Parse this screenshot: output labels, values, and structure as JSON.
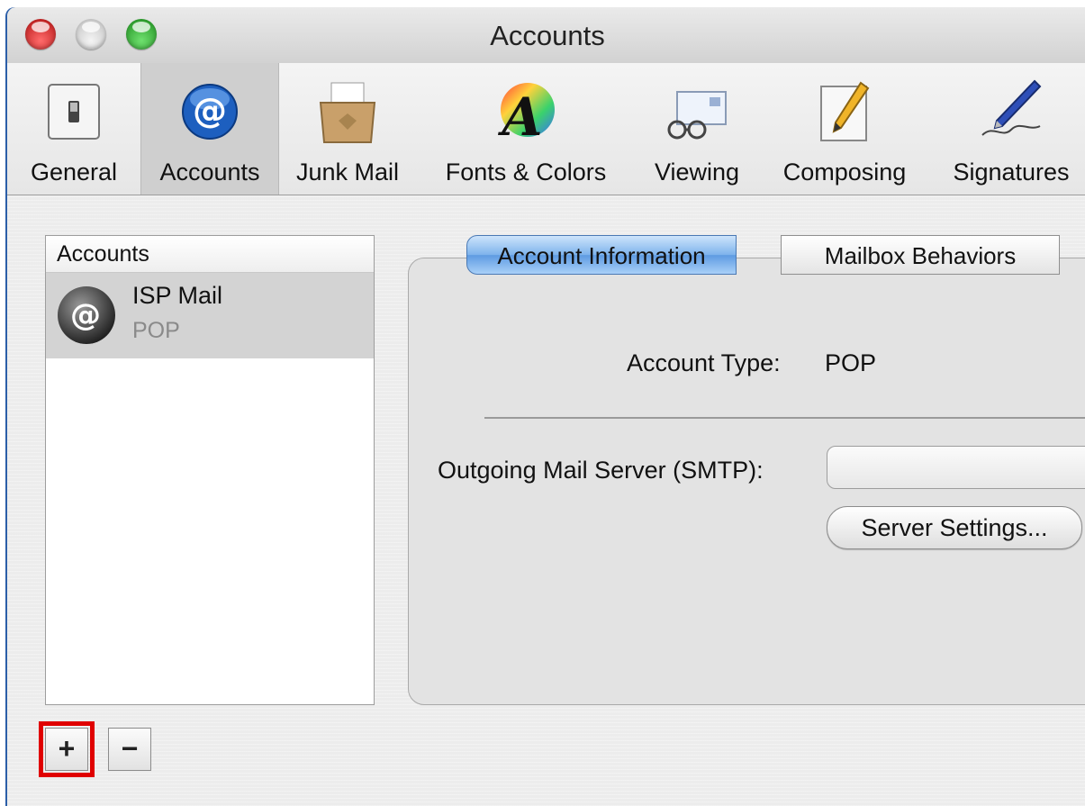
{
  "window": {
    "title": "Accounts"
  },
  "toolbar": {
    "items": [
      {
        "label": "General",
        "icon": "switch-icon"
      },
      {
        "label": "Accounts",
        "icon": "at-sign-icon"
      },
      {
        "label": "Junk Mail",
        "icon": "junk-mail-icon"
      },
      {
        "label": "Fonts & Colors",
        "icon": "color-font-icon"
      },
      {
        "label": "Viewing",
        "icon": "glasses-letter-icon"
      },
      {
        "label": "Composing",
        "icon": "pencil-icon"
      },
      {
        "label": "Signatures",
        "icon": "fountain-pen-icon"
      }
    ],
    "selected": "Accounts"
  },
  "accounts_list": {
    "header": "Accounts",
    "items": [
      {
        "name": "ISP Mail",
        "type": "POP"
      }
    ]
  },
  "list_buttons": {
    "add": "+",
    "remove": "−"
  },
  "tabs": [
    "Account Information",
    "Mailbox Behaviors"
  ],
  "account_info": {
    "type_label": "Account Type:",
    "type_value": "POP",
    "smtp_label": "Outgoing Mail Server (SMTP):",
    "smtp_value": "",
    "server_settings_button": "Server Settings..."
  },
  "colors": {
    "selected_tab": "#7eb3ec",
    "highlight_box": "#e00000",
    "close": "#d42020",
    "zoom": "#2aa52a"
  }
}
